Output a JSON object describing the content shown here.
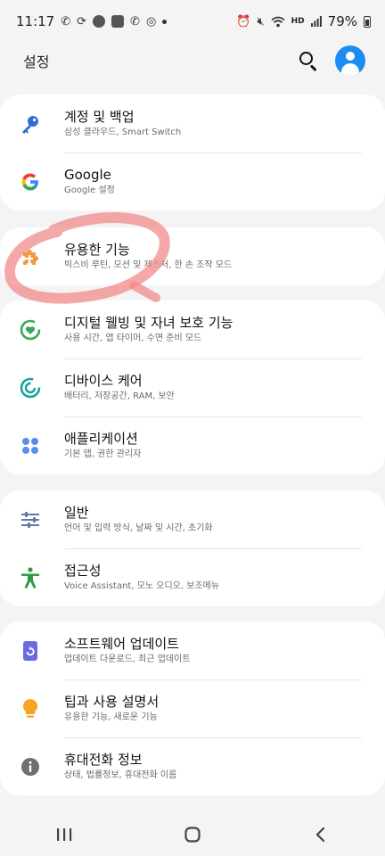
{
  "status_bar": {
    "time": "11:17",
    "battery": "79%",
    "network_label": "HD"
  },
  "header": {
    "title": "설정"
  },
  "colors": {
    "accent_blue": "#1b8cf2",
    "card_bg": "#ffffff",
    "page_bg": "#f4f4f4",
    "scribble": "#f28b8b"
  },
  "groups": [
    {
      "items": [
        {
          "title": "계정 및 백업",
          "subtitle": "삼성 클라우드, Smart Switch",
          "icon": "key-icon"
        },
        {
          "title": "Google",
          "subtitle": "Google 설정",
          "icon": "google-icon"
        }
      ]
    },
    {
      "items": [
        {
          "title": "유용한 기능",
          "subtitle": "빅스비 루틴, 모션 및 제스처, 한 손 조작 모드",
          "icon": "puzzle-plus-icon"
        }
      ]
    },
    {
      "items": [
        {
          "title": "디지털 웰빙 및 자녀 보호 기능",
          "subtitle": "사용 시간, 앱 타이머, 수면 준비 모드",
          "icon": "wellbeing-heart-icon"
        },
        {
          "title": "디바이스 케어",
          "subtitle": "배터리, 저장공간, RAM, 보안",
          "icon": "device-care-icon"
        },
        {
          "title": "애플리케이션",
          "subtitle": "기본 앱, 권한 관리자",
          "icon": "apps-grid-icon"
        }
      ]
    },
    {
      "items": [
        {
          "title": "일반",
          "subtitle": "언어 및 입력 방식, 날짜 및 시간, 초기화",
          "icon": "sliders-icon"
        },
        {
          "title": "접근성",
          "subtitle": "Voice Assistant, 모노 오디오, 보조메뉴",
          "icon": "accessibility-icon"
        }
      ]
    },
    {
      "items": [
        {
          "title": "소프트웨어 업데이트",
          "subtitle": "업데이트 다운로드, 최근 업데이트",
          "icon": "software-update-icon"
        },
        {
          "title": "팁과 사용 설명서",
          "subtitle": "유용한 기능, 새로운 기능",
          "icon": "lightbulb-icon"
        },
        {
          "title": "휴대전화 정보",
          "subtitle": "상태, 법률정보, 휴대전화 이름",
          "icon": "info-icon"
        }
      ]
    }
  ],
  "nav": {
    "recents": "recents-icon",
    "home": "home-icon",
    "back": "back-icon"
  }
}
